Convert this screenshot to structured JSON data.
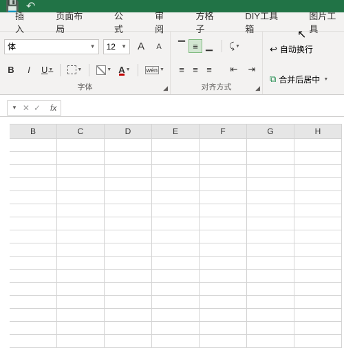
{
  "tabs": {
    "insert": "插入",
    "layout": "页面布局",
    "formula": "公式",
    "review": "审阅",
    "fgz": "方格子",
    "diy": "DIY工具箱",
    "picture": "图片工具"
  },
  "font": {
    "name": "体",
    "size": "12",
    "inc": "A",
    "dec": "A",
    "bold": "B",
    "italic": "I",
    "underline": "U",
    "wen": "wén",
    "group": "字体"
  },
  "align": {
    "group": "对齐方式",
    "wrap": "自动换行",
    "merge": "合并后居中"
  },
  "fx": {
    "label": "fx"
  },
  "cols": [
    "B",
    "C",
    "D",
    "E",
    "F",
    "G",
    "H"
  ]
}
